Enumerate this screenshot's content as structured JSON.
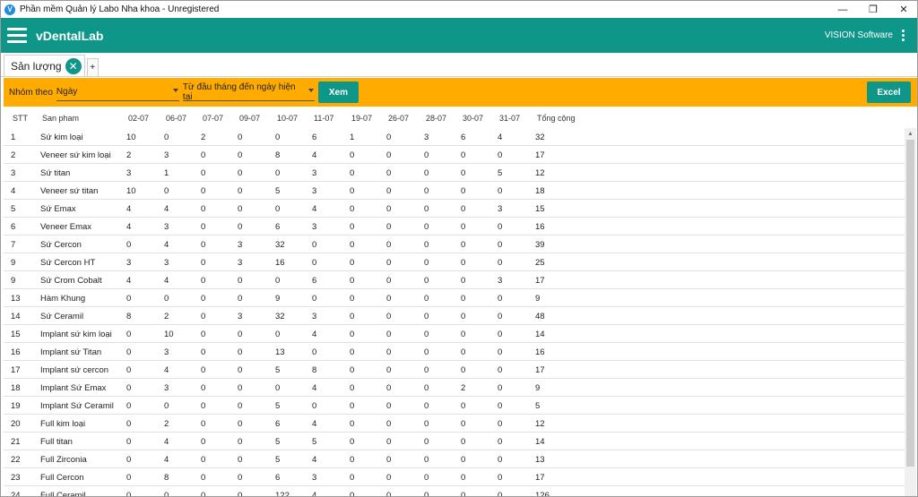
{
  "window": {
    "title": "Phần mềm Quản lý Labo Nha khoa - Unregistered",
    "logo_letter": "V",
    "minimize_glyph": "—",
    "restore_glyph": "❐",
    "close_glyph": "✕"
  },
  "appbar": {
    "app_name": "vDentalLab",
    "vendor": "VISION Software"
  },
  "tabs": [
    {
      "label": "Sản lượng",
      "close_glyph": "✕"
    }
  ],
  "tab_add_glyph": "+",
  "filters": {
    "group_label": "Nhóm theo",
    "group_value": "Ngày",
    "range_value": "Từ đầu tháng đến ngày hiện tại",
    "view_button": "Xem",
    "excel_button": "Excel"
  },
  "table": {
    "columns": [
      "STT",
      "San pham",
      "02-07",
      "06-07",
      "07-07",
      "09-07",
      "10-07",
      "11-07",
      "19-07",
      "26-07",
      "28-07",
      "30-07",
      "31-07",
      "Tổng cộng"
    ],
    "rows": [
      [
        "1",
        "Sứ kim loại",
        "10",
        "0",
        "2",
        "0",
        "0",
        "6",
        "1",
        "0",
        "3",
        "6",
        "4",
        "32"
      ],
      [
        "2",
        "Veneer sứ kim loại",
        "2",
        "3",
        "0",
        "0",
        "8",
        "4",
        "0",
        "0",
        "0",
        "0",
        "0",
        "17"
      ],
      [
        "3",
        "Sứ titan",
        "3",
        "1",
        "0",
        "0",
        "0",
        "3",
        "0",
        "0",
        "0",
        "0",
        "5",
        "12"
      ],
      [
        "4",
        "Veneer sứ titan",
        "10",
        "0",
        "0",
        "0",
        "5",
        "3",
        "0",
        "0",
        "0",
        "0",
        "0",
        "18"
      ],
      [
        "5",
        "Sứ Emax",
        "4",
        "4",
        "0",
        "0",
        "0",
        "4",
        "0",
        "0",
        "0",
        "0",
        "3",
        "15"
      ],
      [
        "6",
        "Veneer Emax",
        "4",
        "3",
        "0",
        "0",
        "6",
        "3",
        "0",
        "0",
        "0",
        "0",
        "0",
        "16"
      ],
      [
        "7",
        "Sứ Cercon",
        "0",
        "4",
        "0",
        "3",
        "32",
        "0",
        "0",
        "0",
        "0",
        "0",
        "0",
        "39"
      ],
      [
        "9",
        "Sứ Cercon HT",
        "3",
        "3",
        "0",
        "3",
        "16",
        "0",
        "0",
        "0",
        "0",
        "0",
        "0",
        "25"
      ],
      [
        "9",
        "Sứ Crom Cobalt",
        "4",
        "4",
        "0",
        "0",
        "0",
        "6",
        "0",
        "0",
        "0",
        "0",
        "3",
        "17"
      ],
      [
        "13",
        "Hàm Khung",
        "0",
        "0",
        "0",
        "0",
        "9",
        "0",
        "0",
        "0",
        "0",
        "0",
        "0",
        "9"
      ],
      [
        "14",
        "Sứ Ceramil",
        "8",
        "2",
        "0",
        "3",
        "32",
        "3",
        "0",
        "0",
        "0",
        "0",
        "0",
        "48"
      ],
      [
        "15",
        "Implant sứ kim loại",
        "0",
        "10",
        "0",
        "0",
        "0",
        "4",
        "0",
        "0",
        "0",
        "0",
        "0",
        "14"
      ],
      [
        "16",
        "Implant sứ Titan",
        "0",
        "3",
        "0",
        "0",
        "13",
        "0",
        "0",
        "0",
        "0",
        "0",
        "0",
        "16"
      ],
      [
        "17",
        "Implant sứ cercon",
        "0",
        "4",
        "0",
        "0",
        "5",
        "8",
        "0",
        "0",
        "0",
        "0",
        "0",
        "17"
      ],
      [
        "18",
        "Implant Sứ Emax",
        "0",
        "3",
        "0",
        "0",
        "0",
        "4",
        "0",
        "0",
        "0",
        "2",
        "0",
        "9"
      ],
      [
        "19",
        "Implant Sứ Ceramil",
        "0",
        "0",
        "0",
        "0",
        "5",
        "0",
        "0",
        "0",
        "0",
        "0",
        "0",
        "5"
      ],
      [
        "20",
        "Full kim loại",
        "0",
        "2",
        "0",
        "0",
        "6",
        "4",
        "0",
        "0",
        "0",
        "0",
        "0",
        "12"
      ],
      [
        "21",
        "Full titan",
        "0",
        "4",
        "0",
        "0",
        "5",
        "5",
        "0",
        "0",
        "0",
        "0",
        "0",
        "14"
      ],
      [
        "22",
        "Full Zirconia",
        "0",
        "4",
        "0",
        "0",
        "5",
        "4",
        "0",
        "0",
        "0",
        "0",
        "0",
        "13"
      ],
      [
        "23",
        "Full Cercon",
        "0",
        "8",
        "0",
        "0",
        "6",
        "3",
        "0",
        "0",
        "0",
        "0",
        "0",
        "17"
      ],
      [
        "24",
        "Full Ceramil",
        "0",
        "0",
        "0",
        "0",
        "122",
        "4",
        "0",
        "0",
        "0",
        "0",
        "0",
        "126"
      ]
    ]
  },
  "colors": {
    "primary": "#0e9688",
    "filter_bar": "#ffab00"
  }
}
